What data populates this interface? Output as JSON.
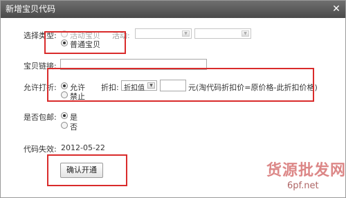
{
  "dialog": {
    "title": "新增宝贝代码",
    "close_glyph": "✕"
  },
  "form": {
    "type_label": "选择类型:",
    "type_options": [
      "活动宝贝",
      "普通宝贝"
    ],
    "activity_label": "活动:",
    "activity_select_1": "",
    "activity_select_2": "",
    "item_link_label": "宝贝链接:",
    "item_link_value": "",
    "allow_discount_label": "允许打折:",
    "discount_options": [
      "允许",
      "禁止"
    ],
    "discount_label": "折扣:",
    "discount_select_value": "折扣值",
    "discount_value": "",
    "discount_note": "元(淘代码折扣价=原价格-此折扣价格)",
    "free_shipping_label": "是否包邮:",
    "shipping_options": [
      "是",
      "否"
    ],
    "code_expiry_label": "代码失效:",
    "code_expiry_value": "2012-05-22",
    "confirm_button": "确认开通"
  },
  "watermark": {
    "line1": "货源批发网",
    "line2": "6pf.net"
  },
  "colors": {
    "highlight": "#d92b2b",
    "titlebar": "#555555"
  }
}
